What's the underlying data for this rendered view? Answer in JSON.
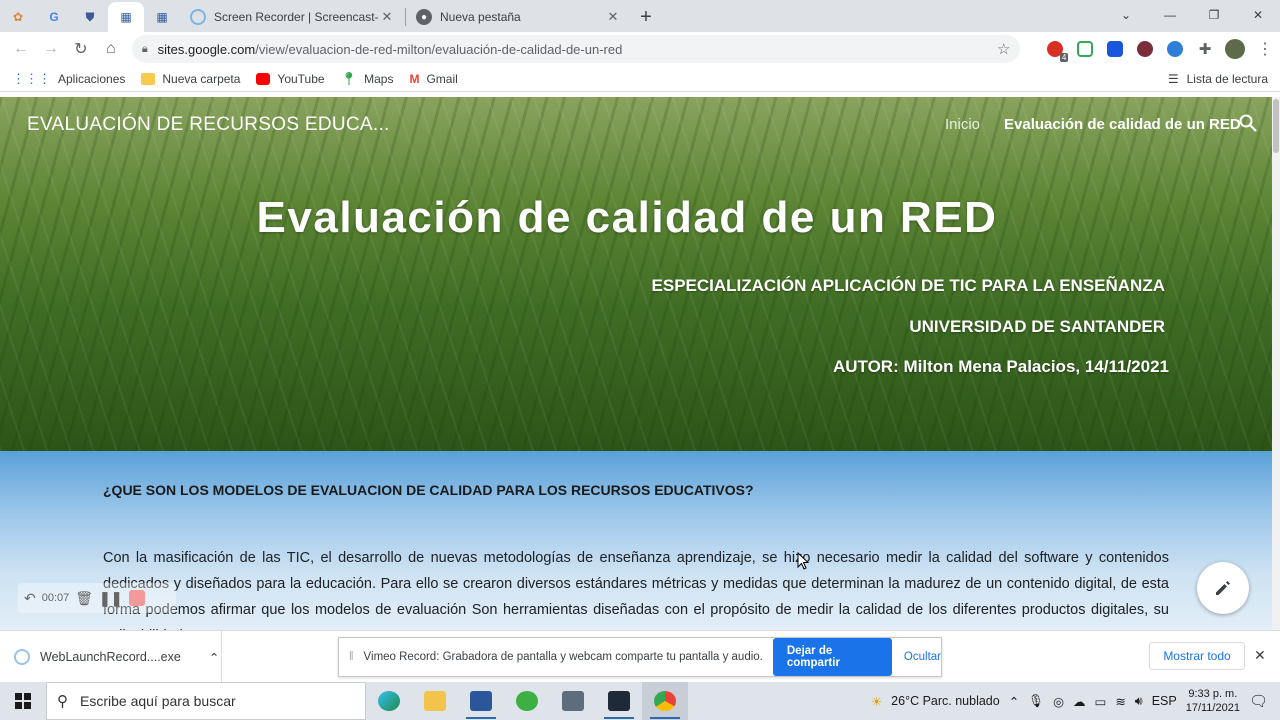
{
  "browser": {
    "tabs": [
      {
        "title": "Screen Recorder | Screencast-O-Matic",
        "active": false
      },
      {
        "title": "Nueva pestaña",
        "active": false
      }
    ],
    "url_host": "sites.google.com",
    "url_path": "/view/evaluacion-de-red-milton/evaluación-de-calidad-de-un-red",
    "ext_badge": "4",
    "bookmarks": [
      "Aplicaciones",
      "Nueva carpeta",
      "YouTube",
      "Maps",
      "Gmail"
    ],
    "reading_list": "Lista de lectura"
  },
  "site": {
    "title": "EVALUACIÓN DE RECURSOS EDUCA...",
    "nav": [
      "Inicio",
      "Evaluación de calidad de un RED"
    ],
    "heading": "Evaluación de calidad de un RED",
    "subtitle1": "ESPECIALIZACIÓN APLICACIÓN DE TIC PARA LA ENSEÑANZA",
    "subtitle2": "UNIVERSIDAD DE SANTANDER",
    "author": "AUTOR: Milton Mena Palacios, 14/11/2021",
    "question": "¿QUE SON LOS MODELOS DE EVALUACION DE CALIDAD PARA LOS RECURSOS EDUCATIVOS?",
    "paragraph": "Con la masificación de las TIC, el desarrollo de nuevas metodologías de enseñanza aprendizaje, se hizo necesario medir la calidad del software y contenidos dedicados y diseñados para la educación. Para ello se crearon diversos estándares métricas y medidas que determinan la madurez de un contenido digital, de esta forma podemos afirmar que los modelos de evaluación Son herramientas diseñadas con el propósito de medir la calidad de los diferentes productos digitales, su aplicabilidad y"
  },
  "recorder": {
    "time": "00:07"
  },
  "downloads": {
    "file": "WebLaunchRecord....exe",
    "share_message": "Vimeo Record: Grabadora de pantalla y webcam comparte tu pantalla y audio.",
    "stop_label": "Dejar de compartir",
    "hide_label": "Ocultar",
    "show_all": "Mostrar todo"
  },
  "taskbar": {
    "search_placeholder": "Escribe aquí para buscar",
    "weather": "26°C  Parc. nublado",
    "lang": "ESP",
    "time": "9:33 p. m.",
    "date": "17/11/2021"
  }
}
